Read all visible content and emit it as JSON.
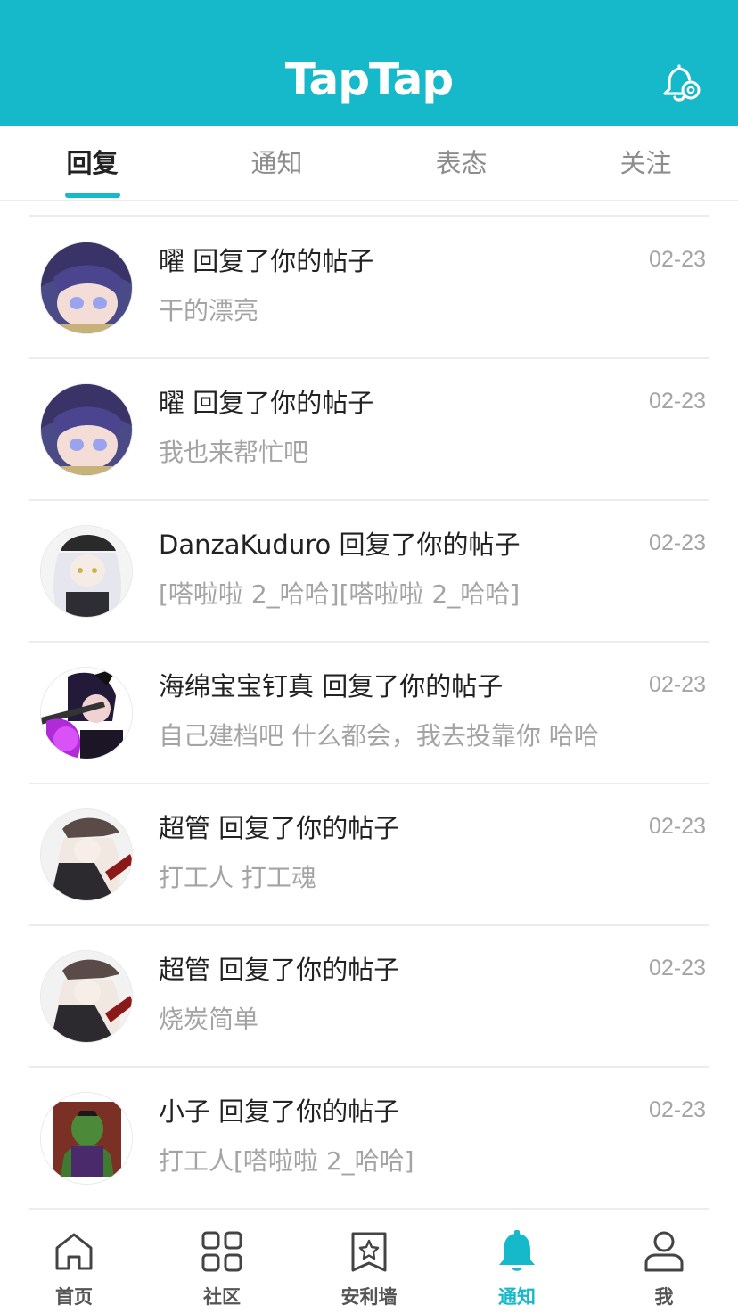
{
  "header": {
    "logo_text": "TapTap",
    "bg_color": "#16b9c9",
    "settings_icon": "bell-settings-icon"
  },
  "tabs": [
    {
      "label": "回复",
      "active": true
    },
    {
      "label": "通知",
      "active": false
    },
    {
      "label": "表态",
      "active": false
    },
    {
      "label": "关注",
      "active": false
    }
  ],
  "notifications": [
    {
      "title": "曜 回复了你的帖子",
      "body": "干的漂亮",
      "date": "02-23"
    },
    {
      "title": "曜 回复了你的帖子",
      "body": "我也来帮忙吧",
      "date": "02-23"
    },
    {
      "title": "DanzaKuduro 回复了你的帖子",
      "body": "[嗒啦啦 2_哈哈][嗒啦啦 2_哈哈]",
      "date": "02-23"
    },
    {
      "title": "海绵宝宝钉真 回复了你的帖子",
      "body": "自己建档吧  什么都会，我去投靠你 哈哈",
      "date": "02-23"
    },
    {
      "title": "超管 回复了你的帖子",
      "body": "打工人 打工魂",
      "date": "02-23"
    },
    {
      "title": "超管 回复了你的帖子",
      "body": "烧炭简单",
      "date": "02-23"
    },
    {
      "title": "小子 回复了你的帖子",
      "body": "打工人[嗒啦啦 2_哈哈]",
      "date": "02-23"
    }
  ],
  "bottom_nav": [
    {
      "label": "首页",
      "icon": "home-icon"
    },
    {
      "label": "社区",
      "icon": "grid-icon"
    },
    {
      "label": "安利墙",
      "icon": "bookmark-star-icon"
    },
    {
      "label": "通知",
      "icon": "bell-icon",
      "active": true
    },
    {
      "label": "我",
      "icon": "user-icon"
    }
  ],
  "colors": {
    "accent": "#16b9c9",
    "text": "#222222",
    "muted": "#a4a4a4"
  }
}
